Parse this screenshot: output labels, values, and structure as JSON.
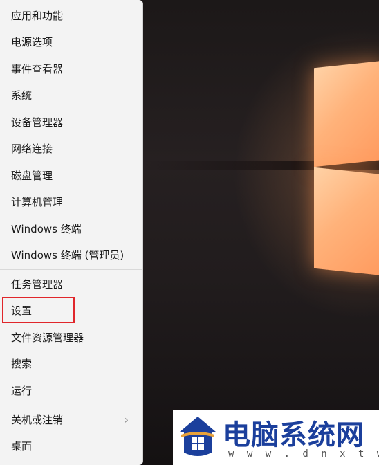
{
  "menu": {
    "items": [
      {
        "label": "应用和功能"
      },
      {
        "label": "电源选项"
      },
      {
        "label": "事件查看器"
      },
      {
        "label": "系统"
      },
      {
        "label": "设备管理器"
      },
      {
        "label": "网络连接"
      },
      {
        "label": "磁盘管理"
      },
      {
        "label": "计算机管理"
      },
      {
        "label": "Windows 终端"
      },
      {
        "label": "Windows 终端 (管理员)"
      },
      {
        "label": "任务管理器"
      },
      {
        "label": "设置"
      },
      {
        "label": "文件资源管理器"
      },
      {
        "label": "搜索"
      },
      {
        "label": "运行"
      },
      {
        "label": "关机或注销",
        "submenu_indicator": "›"
      },
      {
        "label": "桌面"
      }
    ],
    "highlighted_item": "设置",
    "highlight_color": "#e0262b"
  },
  "watermark": {
    "title": "电脑系统网",
    "url": "w w w . d n x t w . c o m",
    "brand_color": "#1b3f9c"
  }
}
